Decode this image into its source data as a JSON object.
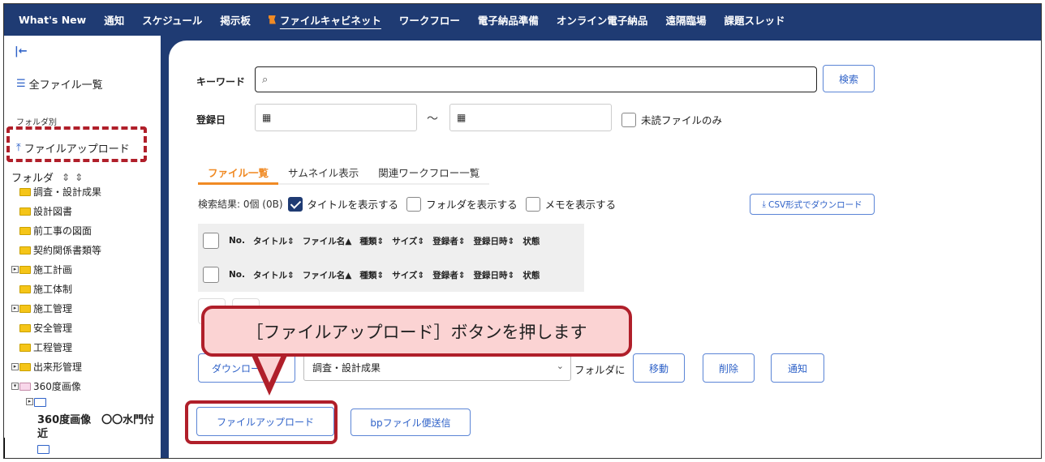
{
  "nav": {
    "items": [
      {
        "label": "What's New"
      },
      {
        "label": "通知"
      },
      {
        "label": "スケジュール"
      },
      {
        "label": "掲示板"
      },
      {
        "label": "ファイルキャビネット",
        "active": true
      },
      {
        "label": "ワークフロー"
      },
      {
        "label": "電子納品準備"
      },
      {
        "label": "オンライン電子納品"
      },
      {
        "label": "遠隔臨場"
      },
      {
        "label": "課題スレッド"
      }
    ]
  },
  "sidebar": {
    "collapse_glyph": "|←",
    "all_files": "全ファイル一覧",
    "by_folder_label": "フォルダ別",
    "upload_label": "ファイルアップロード",
    "folder_heading": "フォルダ",
    "folder_sort_glyph": "⇕⇕",
    "tree": [
      {
        "label": "調査・設計成果"
      },
      {
        "label": "設計図書"
      },
      {
        "label": "前工事の図面"
      },
      {
        "label": "契約関係書類等"
      },
      {
        "label": "施工計画",
        "expandable": true
      },
      {
        "label": "施工体制"
      },
      {
        "label": "施工管理",
        "expandable": true
      },
      {
        "label": "安全管理"
      },
      {
        "label": "工程管理"
      },
      {
        "label": "出来形管理",
        "expandable": true
      },
      {
        "label": "360度画像",
        "expandable": true,
        "expanded": true
      },
      {
        "label": "360度画像　〇〇水門付近"
      }
    ]
  },
  "search": {
    "keyword_label": "キーワード",
    "keyword_value": "",
    "search_button": "検索",
    "date_label": "登録日",
    "date_separator": "～",
    "unread_only_label": "未読ファイルのみ"
  },
  "tabs": [
    {
      "label": "ファイル一覧",
      "active": true
    },
    {
      "label": "サムネイル表示"
    },
    {
      "label": "関連ワークフロー一覧"
    }
  ],
  "results": {
    "count": "検索結果: 0個 (0B)",
    "show_title": "タイトルを表示する",
    "show_folder": "フォルダを表示する",
    "show_memo": "メモを表示する",
    "csv_button": "CSV形式でダウンロード"
  },
  "table": {
    "columns": [
      "No.",
      "タイトル",
      "ファイル名",
      "種類",
      "サイズ",
      "登録者",
      "登録日時",
      "状態"
    ],
    "sort_glyphs": [
      "",
      "⇕",
      "▲",
      "⇕",
      "⇕",
      "⇕",
      "⇕",
      ""
    ]
  },
  "actions": {
    "download_button": "ダウンロード",
    "folder_select_value": "調査・設計成果",
    "folder_to_label": "フォルダに",
    "move_button": "移動",
    "delete_button": "削除",
    "notify_button": "通知",
    "upload_button": "ファイルアップロード",
    "bp_button": "bpファイル便送信"
  },
  "callout": {
    "text": "［ファイルアップロード］ボタンを押します"
  },
  "colors": {
    "nav_bg": "#1f3b73",
    "accent_orange": "#f08a24",
    "link_blue": "#2f62c8",
    "highlight_red": "#b01f2a",
    "callout_bg": "#fbd3d3"
  }
}
